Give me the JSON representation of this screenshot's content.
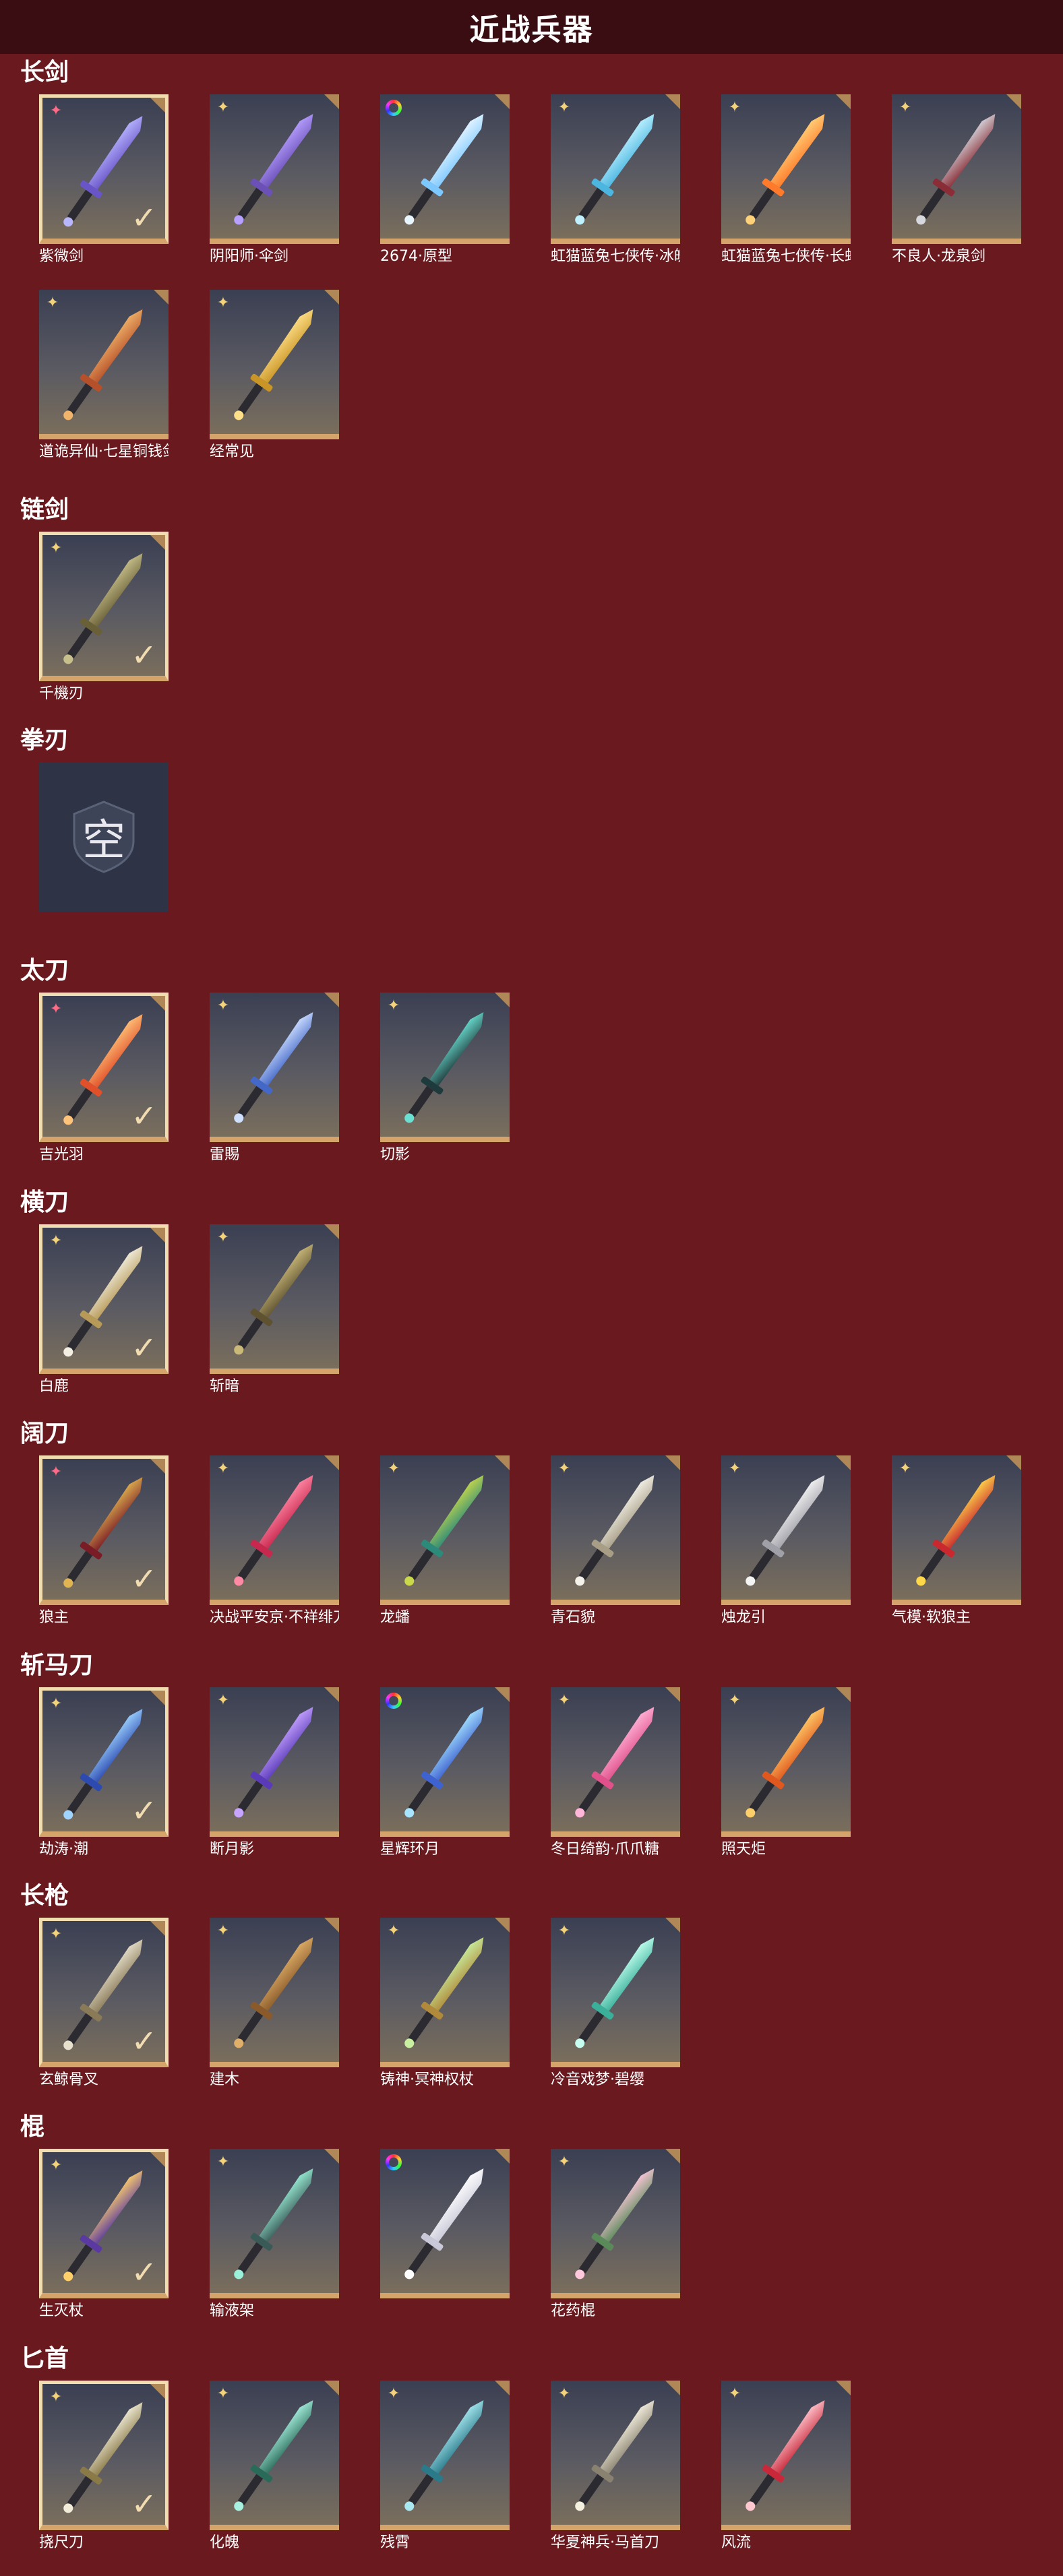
{
  "title": "近战兵器",
  "sections": [
    {
      "name": "长剑",
      "items": [
        {
          "name": "紫微剑",
          "badge": "pink",
          "selected": true,
          "c1": "#b8b6ff",
          "c2": "#6a55c8"
        },
        {
          "name": "阴阳师·伞剑",
          "badge": "gold",
          "selected": false,
          "c1": "#b7a0ff",
          "c2": "#6b50b8"
        },
        {
          "name": "2674·原型",
          "badge": "rainbow",
          "selected": false,
          "c1": "#e8f6ff",
          "c2": "#7cc8ff"
        },
        {
          "name": "虹猫蓝兔七侠传·冰魄剑",
          "badge": "gold",
          "selected": false,
          "c1": "#bff1ff",
          "c2": "#4bb6e0"
        },
        {
          "name": "虹猫蓝兔七侠传·长虹剑",
          "badge": "gold",
          "selected": false,
          "c1": "#ffd27a",
          "c2": "#ff7a2a"
        },
        {
          "name": "不良人·龙泉剑",
          "badge": "gold",
          "selected": false,
          "c1": "#d6d8de",
          "c2": "#8a2d36"
        },
        {
          "name": "道诡异仙·七星铜钱剑",
          "badge": "gold",
          "selected": false,
          "c1": "#f0b46a",
          "c2": "#b6502a"
        },
        {
          "name": "经常见",
          "badge": "gold",
          "selected": false,
          "c1": "#ffe08a",
          "c2": "#c99526"
        }
      ]
    },
    {
      "name": "链剑",
      "items": [
        {
          "name": "千機刃",
          "badge": "gold",
          "selected": true,
          "c1": "#c8c08c",
          "c2": "#6a6038"
        }
      ]
    },
    {
      "name": "拳刃",
      "items": [
        {
          "name": "",
          "empty": true,
          "glyph": "空",
          "badge": "none",
          "selected": false
        }
      ]
    },
    {
      "name": "太刀",
      "items": [
        {
          "name": "吉光羽",
          "badge": "pink",
          "selected": true,
          "c1": "#ffc47a",
          "c2": "#e0502a"
        },
        {
          "name": "雷賜",
          "badge": "gold",
          "selected": false,
          "c1": "#cfe0ff",
          "c2": "#4468c8"
        },
        {
          "name": "切影",
          "badge": "gold",
          "selected": false,
          "c1": "#6ae0d2",
          "c2": "#1f3a3c"
        }
      ]
    },
    {
      "name": "横刀",
      "items": [
        {
          "name": "白鹿",
          "badge": "gold",
          "selected": true,
          "c1": "#f2efe2",
          "c2": "#b89a58"
        },
        {
          "name": "斩暗",
          "badge": "gold",
          "selected": false,
          "c1": "#cbb97a",
          "c2": "#5e5230"
        }
      ]
    },
    {
      "name": "阔刀",
      "items": [
        {
          "name": "狼主",
          "badge": "pink",
          "selected": true,
          "c1": "#e0b450",
          "c2": "#7a1c26"
        },
        {
          "name": "决战平安京·不祥绯刀",
          "badge": "gold",
          "selected": false,
          "c1": "#ff8aa6",
          "c2": "#c8284e"
        },
        {
          "name": "龙蟠",
          "badge": "gold",
          "selected": false,
          "c1": "#c8d84a",
          "c2": "#2c8a7a"
        },
        {
          "name": "青石貌",
          "badge": "gold",
          "selected": false,
          "c1": "#f4f2ea",
          "c2": "#a89e86"
        },
        {
          "name": "烛龙引",
          "badge": "gold",
          "selected": false,
          "c1": "#f4f4f4",
          "c2": "#a0a0a8"
        },
        {
          "name": "气模·软狼主",
          "badge": "gold",
          "selected": false,
          "c1": "#ffd84a",
          "c2": "#c8282e"
        }
      ]
    },
    {
      "name": "斩马刀",
      "items": [
        {
          "name": "劫涛·潮",
          "badge": "gold",
          "selected": true,
          "c1": "#9ed4ff",
          "c2": "#2c4ab0"
        },
        {
          "name": "断月影",
          "badge": "gold",
          "selected": false,
          "c1": "#c6a4ff",
          "c2": "#5a3ab8"
        },
        {
          "name": "星辉环月",
          "badge": "rainbow",
          "selected": false,
          "c1": "#a6e4ff",
          "c2": "#3e62d0"
        },
        {
          "name": "冬日绮韵·爪爪糖",
          "badge": "gold",
          "selected": false,
          "c1": "#ffb6d8",
          "c2": "#e0508a"
        },
        {
          "name": "照天炬",
          "badge": "gold",
          "selected": false,
          "c1": "#ffcf6a",
          "c2": "#e0581e"
        }
      ]
    },
    {
      "name": "长枪",
      "items": [
        {
          "name": "玄鲸骨叉",
          "badge": "gold",
          "selected": true,
          "c1": "#e6e0cc",
          "c2": "#8a7a58"
        },
        {
          "name": "建木",
          "badge": "gold",
          "selected": false,
          "c1": "#e0b06a",
          "c2": "#8a5a2a"
        },
        {
          "name": "铸神·冥神权杖",
          "badge": "gold",
          "selected": false,
          "c1": "#c8f0a0",
          "c2": "#b08a3a"
        },
        {
          "name": "冷音戏梦·碧缨",
          "badge": "gold",
          "selected": false,
          "c1": "#c6fff0",
          "c2": "#3ab09a"
        }
      ]
    },
    {
      "name": "棍",
      "items": [
        {
          "name": "生灭杖",
          "badge": "gold",
          "selected": true,
          "c1": "#ffd06a",
          "c2": "#5a3aa0"
        },
        {
          "name": "输液架",
          "badge": "gold",
          "selected": false,
          "c1": "#9af0d8",
          "c2": "#3a5a58"
        },
        {
          "name": "",
          "badge": "rainbow",
          "selected": false,
          "c1": "#ffffff",
          "c2": "#c8c8d8"
        },
        {
          "name": "花药棍",
          "badge": "gold",
          "selected": false,
          "c1": "#ffc8dc",
          "c2": "#5a8a5a"
        }
      ]
    },
    {
      "name": "匕首",
      "items": [
        {
          "name": "挠尺刀",
          "badge": "gold",
          "selected": true,
          "c1": "#f0ecd8",
          "c2": "#8a7a48"
        },
        {
          "name": "化魄",
          "badge": "gold",
          "selected": false,
          "c1": "#a8f0e0",
          "c2": "#2a6a58"
        },
        {
          "name": "残霄",
          "badge": "gold",
          "selected": false,
          "c1": "#a8e8f0",
          "c2": "#2a7a8a"
        },
        {
          "name": "华夏神兵·马首刀",
          "badge": "gold",
          "selected": false,
          "c1": "#f4f0e0",
          "c2": "#8a8270"
        },
        {
          "name": "风流",
          "badge": "gold",
          "selected": false,
          "c1": "#ffc8d0",
          "c2": "#c8283a"
        }
      ]
    }
  ],
  "check_glyph": "✓",
  "badge_glyph": "✦"
}
